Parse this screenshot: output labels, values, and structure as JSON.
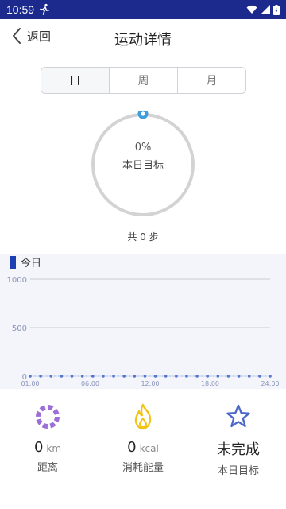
{
  "status_bar": {
    "time": "10:59"
  },
  "header": {
    "back_label": "返回",
    "title": "运动详情"
  },
  "tabs": [
    {
      "label": "日",
      "active": true
    },
    {
      "label": "周",
      "active": false
    },
    {
      "label": "月",
      "active": false
    }
  ],
  "progress": {
    "percent_text": "0%",
    "percent": 0,
    "label": "本日目标"
  },
  "total_steps": "共 0 步",
  "chart_data": {
    "type": "line",
    "title": "今日",
    "x": [
      "01:00",
      "06:00",
      "12:00",
      "18:00",
      "24:00"
    ],
    "y_ticks": [
      0,
      500,
      1000
    ],
    "ylim": [
      0,
      1000
    ],
    "values": [
      0,
      0,
      0,
      0,
      0,
      0,
      0,
      0,
      0,
      0,
      0,
      0,
      0,
      0,
      0,
      0,
      0,
      0,
      0,
      0,
      0,
      0,
      0,
      0
    ],
    "grid": true
  },
  "stats": {
    "distance": {
      "value": "0",
      "unit": "km",
      "label": "距离",
      "icon": "distance-ring-icon"
    },
    "calories": {
      "value": "0",
      "unit": "kcal",
      "label": "消耗能量",
      "icon": "flame-icon"
    },
    "goal": {
      "value": "未完成",
      "label": "本日目标",
      "icon": "star-icon"
    }
  },
  "colors": {
    "status_bar": "#1b2a8c",
    "accent": "#1b3fb0",
    "ring_track": "#d3d3d3",
    "ring_knob": "#3b9cde",
    "distance": "#9b6fd6",
    "calories": "#f2c417",
    "goal": "#4a67c9"
  }
}
